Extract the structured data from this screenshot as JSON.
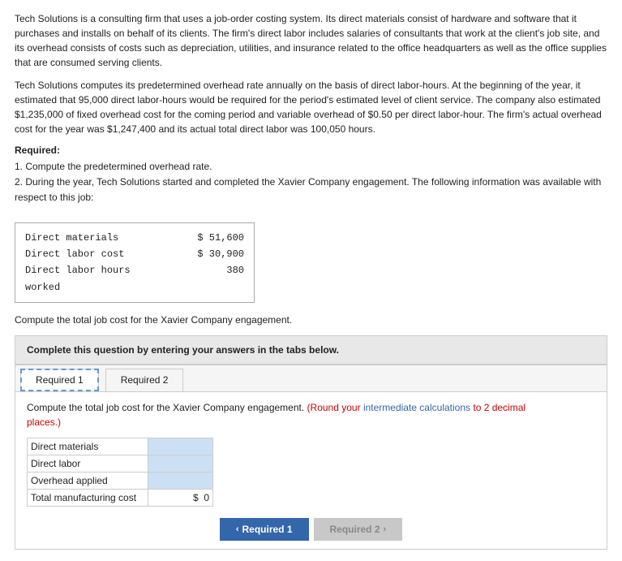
{
  "paragraphs": [
    "Tech Solutions is a consulting firm that uses a job-order costing system. Its direct materials consist of hardware and software that it purchases and installs on behalf of its clients. The firm's direct labor includes salaries of consultants that work at the client's job site, and its overhead consists of costs such as depreciation, utilities, and insurance related to the office headquarters as well as the office supplies that are consumed serving clients.",
    "Tech Solutions computes its predetermined overhead rate annually on the basis of direct labor-hours. At the beginning of the year, it estimated that 95,000 direct labor-hours would be required for the period's estimated level of client service. The company also estimated $1,235,000 of fixed overhead cost for the coming period and variable overhead of $0.50 per direct labor-hour. The firm's actual overhead cost for the year was $1,247,400 and its actual total direct labor was 100,050 hours."
  ],
  "required_label": "Required:",
  "required_items": [
    "1. Compute the predetermined overhead rate.",
    "2. During the year, Tech Solutions started and completed the Xavier Company engagement. The following information was available with respect to this job:"
  ],
  "data_table": {
    "rows": [
      {
        "label": "Direct materials",
        "value": "$ 51,600"
      },
      {
        "label": "Direct labor cost",
        "value": "$ 30,900"
      },
      {
        "label": "Direct labor hours worked",
        "value": "380"
      }
    ]
  },
  "compute_text": "Compute the total job cost for the Xavier Company engagement.",
  "complete_box_text": "Complete this question by entering your answers in the tabs below.",
  "tabs": [
    {
      "id": "req1",
      "label": "Required 1"
    },
    {
      "id": "req2",
      "label": "Required 2"
    }
  ],
  "active_tab": "req1",
  "tab_instruction": "Compute the total job cost for the Xavier Company engagement.",
  "tab_note": "(Round your intermediate calculations to 2 decimal places.)",
  "cost_rows": [
    {
      "label": "Direct materials",
      "value": ""
    },
    {
      "label": "Direct labor",
      "value": ""
    },
    {
      "label": "Overhead applied",
      "value": ""
    },
    {
      "label": "Total manufacturing cost",
      "value": "0"
    }
  ],
  "dollar_sign": "$",
  "nav_buttons": {
    "prev": {
      "label": "Required 1",
      "arrow": "‹"
    },
    "next": {
      "label": "Required 2",
      "arrow": "›"
    }
  }
}
